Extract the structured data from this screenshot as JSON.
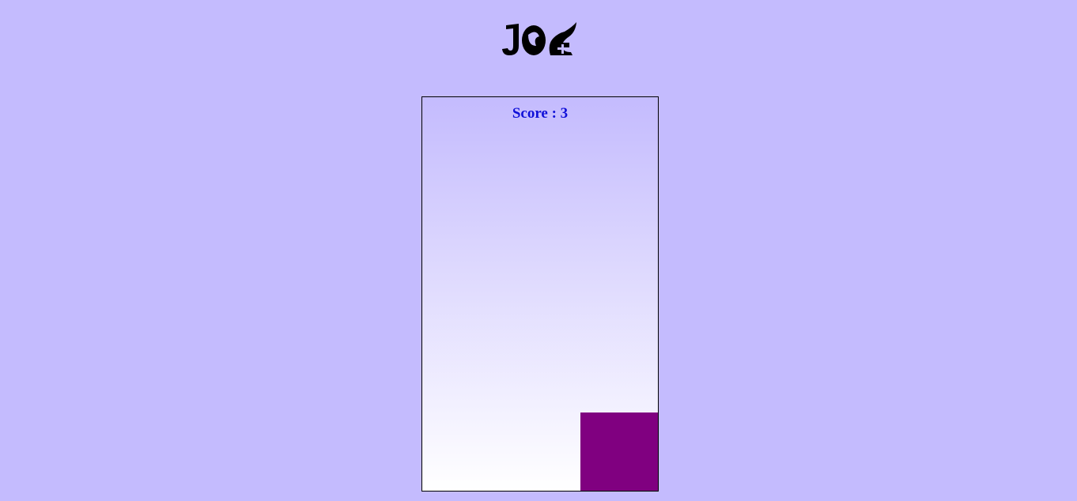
{
  "logo": {
    "icon": "joe-logo-icon"
  },
  "score": {
    "label": "Score : ",
    "value": "3"
  },
  "board": {
    "columns": 3,
    "rows": 5,
    "blocks": [
      {
        "col": 2,
        "row": 4,
        "color": "#800080"
      }
    ]
  },
  "colors": {
    "background": "#c4bbfe",
    "score_text": "#1010d8",
    "block": "#800080"
  }
}
